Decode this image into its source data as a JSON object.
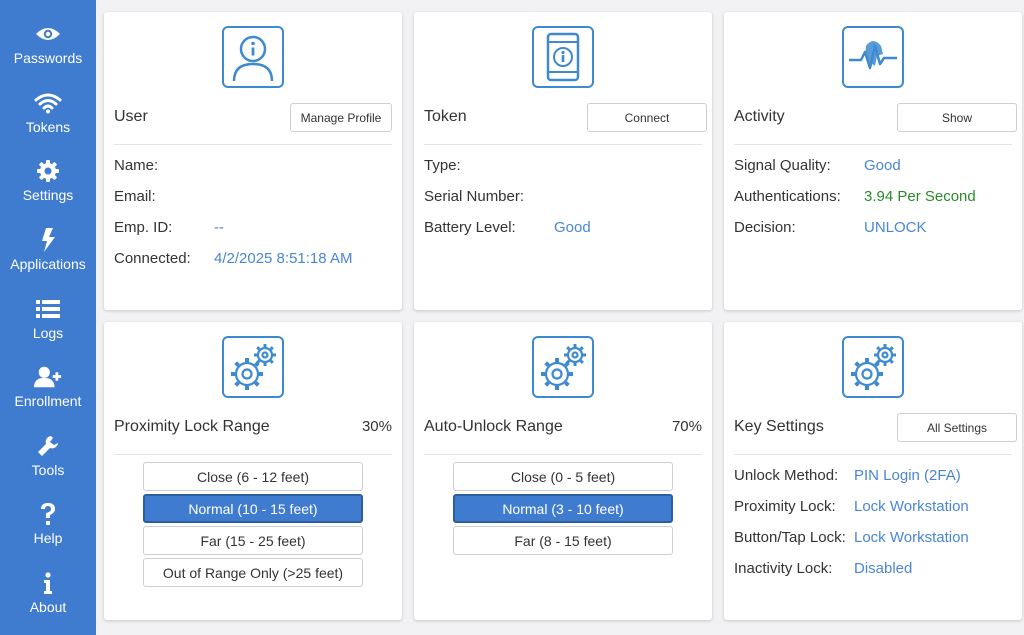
{
  "sidebar": {
    "items": [
      {
        "label": "Passwords",
        "icon": "eye-icon"
      },
      {
        "label": "Tokens",
        "icon": "wifi-icon"
      },
      {
        "label": "Settings",
        "icon": "gear-icon"
      },
      {
        "label": "Applications",
        "icon": "lightning-icon"
      },
      {
        "label": "Logs",
        "icon": "list-icon"
      },
      {
        "label": "Enrollment",
        "icon": "add-user-icon"
      },
      {
        "label": "Tools",
        "icon": "wrench-icon"
      },
      {
        "label": "Help",
        "icon": "question-icon"
      },
      {
        "label": "About",
        "icon": "info-icon"
      }
    ]
  },
  "user_card": {
    "title": "User",
    "button": "Manage Profile",
    "rows": [
      {
        "label": "Name:",
        "value": ""
      },
      {
        "label": "Email:",
        "value": ""
      },
      {
        "label": "Emp. ID:",
        "value": "--"
      },
      {
        "label": "Connected:",
        "value": "4/2/2025 8:51:18 AM"
      }
    ]
  },
  "token_card": {
    "title": "Token",
    "button": "Connect",
    "rows": [
      {
        "label": "Type:",
        "value": ""
      },
      {
        "label": "Serial Number:",
        "value": ""
      },
      {
        "label": "Battery Level:",
        "value": "Good"
      }
    ]
  },
  "activity_card": {
    "title": "Activity",
    "button": "Show",
    "rows": [
      {
        "label": "Signal Quality:",
        "value": "Good"
      },
      {
        "label": "Authentications:",
        "value": "3.94 Per Second"
      },
      {
        "label": "Decision:",
        "value": "UNLOCK"
      }
    ]
  },
  "proximity_card": {
    "title": "Proximity Lock Range",
    "value": "30%",
    "options": [
      "Close (6 - 12 feet)",
      "Normal (10 - 15 feet)",
      "Far (15 - 25 feet)",
      "Out of Range Only (>25 feet)"
    ],
    "selected": 1
  },
  "autounlock_card": {
    "title": "Auto-Unlock Range",
    "value": "70%",
    "options": [
      "Close (0 - 5 feet)",
      "Normal (3 - 10 feet)",
      "Far (8 - 15 feet)"
    ],
    "selected": 1
  },
  "keysettings_card": {
    "title": "Key Settings",
    "button": "All Settings",
    "rows": [
      {
        "label": "Unlock Method:",
        "value": "PIN Login (2FA)"
      },
      {
        "label": "Proximity Lock:",
        "value": "Lock Workstation"
      },
      {
        "label": "Button/Tap Lock:",
        "value": "Lock Workstation"
      },
      {
        "label": "Inactivity Lock:",
        "value": "Disabled"
      }
    ]
  },
  "colors": {
    "sidebar": "#3f7bcf",
    "accent": "#4a86d4",
    "success": "#2a8a2a"
  }
}
